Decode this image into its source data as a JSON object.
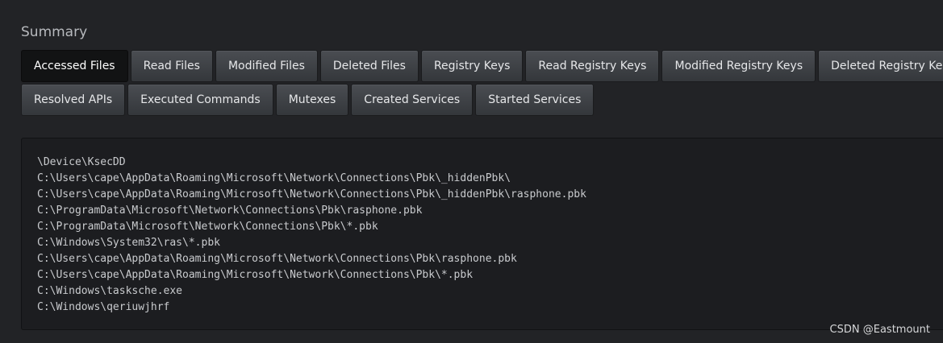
{
  "summary": {
    "title": "Summary"
  },
  "tabs": {
    "row1": [
      "Accessed Files",
      "Read Files",
      "Modified Files",
      "Deleted Files",
      "Registry Keys",
      "Read Registry Keys",
      "Modified Registry Keys",
      "Deleted Registry Keys"
    ],
    "row2": [
      "Resolved APIs",
      "Executed Commands",
      "Mutexes",
      "Created Services",
      "Started Services"
    ],
    "active": "Accessed Files"
  },
  "files": [
    "\\Device\\KsecDD",
    "C:\\Users\\cape\\AppData\\Roaming\\Microsoft\\Network\\Connections\\Pbk\\_hiddenPbk\\",
    "C:\\Users\\cape\\AppData\\Roaming\\Microsoft\\Network\\Connections\\Pbk\\_hiddenPbk\\rasphone.pbk",
    "C:\\ProgramData\\Microsoft\\Network\\Connections\\Pbk\\rasphone.pbk",
    "C:\\ProgramData\\Microsoft\\Network\\Connections\\Pbk\\*.pbk",
    "C:\\Windows\\System32\\ras\\*.pbk",
    "C:\\Users\\cape\\AppData\\Roaming\\Microsoft\\Network\\Connections\\Pbk\\rasphone.pbk",
    "C:\\Users\\cape\\AppData\\Roaming\\Microsoft\\Network\\Connections\\Pbk\\*.pbk",
    "C:\\Windows\\tasksche.exe",
    "C:\\Windows\\qeriuwjhrf"
  ],
  "watermark": "CSDN @Eastmount"
}
